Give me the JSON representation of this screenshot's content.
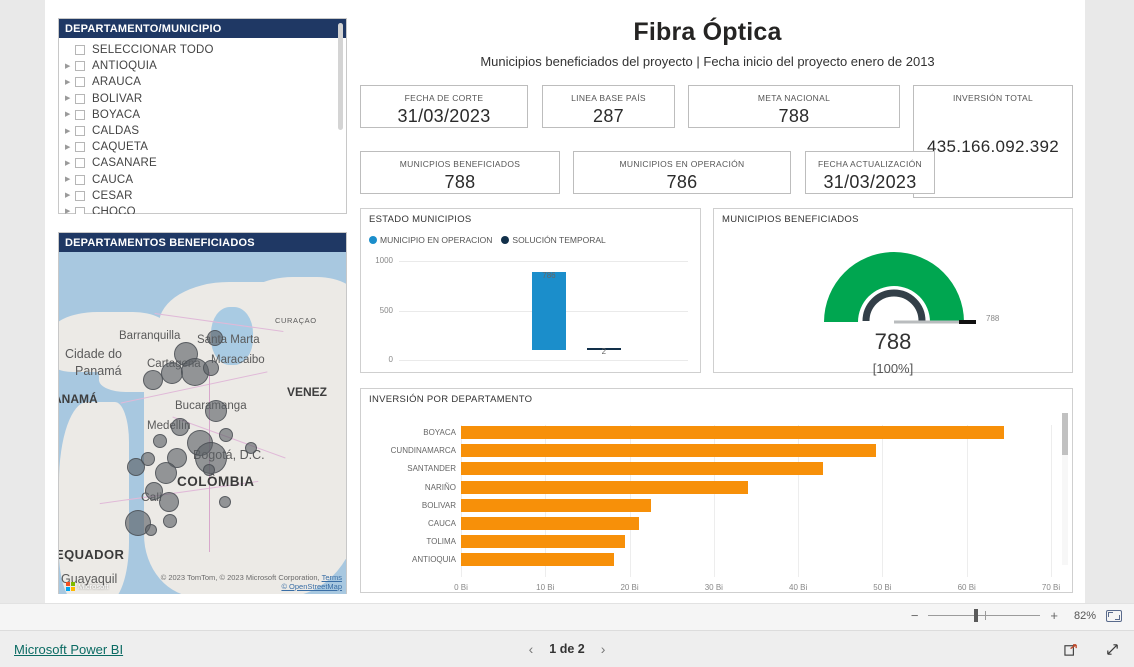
{
  "report": {
    "title": "Fibra Óptica",
    "subtitle": "Municipios beneficiados del proyecto | Fecha inicio del proyecto enero de 2013"
  },
  "slicer": {
    "header": "DEPARTAMENTO/MUNICIPIO",
    "items": [
      {
        "label": "SELECCIONAR TODO",
        "expandable": false
      },
      {
        "label": "ANTIOQUIA",
        "expandable": true
      },
      {
        "label": "ARAUCA",
        "expandable": true
      },
      {
        "label": "BOLIVAR",
        "expandable": true
      },
      {
        "label": "BOYACA",
        "expandable": true
      },
      {
        "label": "CALDAS",
        "expandable": true
      },
      {
        "label": "CAQUETA",
        "expandable": true
      },
      {
        "label": "CASANARE",
        "expandable": true
      },
      {
        "label": "CAUCA",
        "expandable": true
      },
      {
        "label": "CESAR",
        "expandable": true
      },
      {
        "label": "CHOCO",
        "expandable": true
      }
    ]
  },
  "map": {
    "header": "DEPARTAMENTOS BENEFICIADOS",
    "labels": [
      "Barranquilla",
      "Santa Marta",
      "CURAÇAO",
      "Cidade do",
      "Panamá",
      "Cartagena",
      "Maracaibo",
      "VENEZ",
      "PANAMÁ",
      "Bucaramanga",
      "Medellín",
      "Bogotá, D.C.",
      "COLÔMBIA",
      "Cali",
      "EQUADOR",
      "Guayaquil"
    ],
    "attribution": "© 2023 TomTom, © 2023 Microsoft Corporation,",
    "attribution_terms": "Terms",
    "attribution_osm": "© OpenStreetMap",
    "brand": "Microsoft"
  },
  "kpis": [
    {
      "caption": "FECHA DE CORTE",
      "value": "31/03/2023"
    },
    {
      "caption": "LINEA BASE PAÍS",
      "value": "287"
    },
    {
      "caption": "META NACIONAL",
      "value": "788"
    },
    {
      "caption": "INVERSIÓN TOTAL",
      "value": "435.166.092.392"
    },
    {
      "caption": "MUNICPIOS BENEFICIADOS",
      "value": "788"
    },
    {
      "caption": "MUNICIPIOS EN OPERACIÓN",
      "value": "786"
    },
    {
      "caption": "FECHA ACTUALIZACIÓN",
      "value": "31/03/2023"
    }
  ],
  "gauge": {
    "title": "MUNICIPIOS BENEFICIADOS",
    "value": "788",
    "percent": "[100%]",
    "target_label": "788",
    "color": "#00a650"
  },
  "zoom": {
    "percent": "82%",
    "minus": "−",
    "plus": "+"
  },
  "footer": {
    "brand": "Microsoft Power BI",
    "page": "1 de 2",
    "prev": "‹",
    "next": "›"
  },
  "chart_data": [
    {
      "type": "bar",
      "title": "ESTADO  MUNICIPIOS",
      "categories": [
        "MUNICIPIO EN OPERACION",
        "SOLUCIÓN TEMPORAL"
      ],
      "values": [
        786,
        2
      ],
      "colors": [
        "#1b8ecb",
        "#12304a"
      ],
      "legend": [
        "MUNICIPIO EN OPERACION",
        "SOLUCIÓN TEMPORAL"
      ],
      "legend_position": "top",
      "ylabel": "",
      "xlabel": "",
      "ylim": [
        0,
        1000
      ],
      "yticks": [
        0,
        500,
        1000
      ],
      "ytick_labels": [
        "0",
        "500",
        "1000"
      ],
      "grid": true,
      "data_labels": [
        "786",
        "2"
      ]
    },
    {
      "type": "bar",
      "orientation": "horizontal",
      "title": "INVERSIÓN  POR DEPARTAMENTO",
      "categories": [
        "BOYACA",
        "CUNDINAMARCA",
        "SANTANDER",
        "NARIÑO",
        "BOLIVAR",
        "CAUCA",
        "TOLIMA",
        "ANTIOQUIA"
      ],
      "values": [
        64.4,
        49.2,
        42.9,
        34.1,
        22.5,
        21.1,
        19.4,
        18.2
      ],
      "color": "#f79009",
      "xlabel": "",
      "ylabel": "",
      "xlim": [
        0,
        70
      ],
      "xticks": [
        0,
        10,
        20,
        30,
        40,
        50,
        60,
        70
      ],
      "xtick_labels": [
        "0 Bi",
        "10 Bi",
        "20 Bi",
        "30 Bi",
        "40 Bi",
        "50 Bi",
        "60 Bi",
        "70 Bi"
      ],
      "unit": "Bi",
      "grid": true
    },
    {
      "type": "gauge",
      "title": "MUNICIPIOS BENEFICIADOS",
      "value": 788,
      "min": 0,
      "max": 788,
      "target": 788,
      "percent": 100,
      "color": "#00a650"
    }
  ]
}
